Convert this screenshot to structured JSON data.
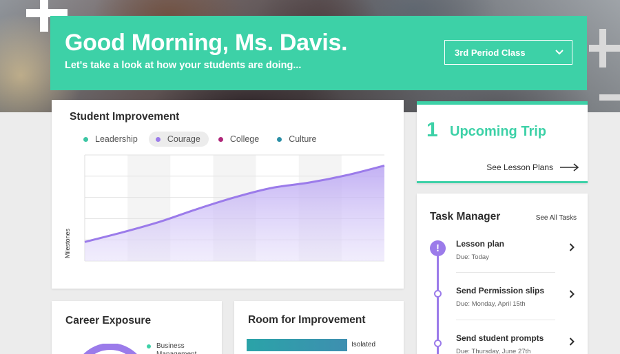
{
  "colors": {
    "accent_green": "#3dd1a7",
    "accent_purple": "#9b7bea",
    "teal": "#2aa3a8",
    "magenta": "#b0287a",
    "blue_teal": "#2b8fa6"
  },
  "banner": {
    "greeting": "Good Morning, Ms. Davis.",
    "subtitle": "Let's take a look at how your students are doing...",
    "class_select": "3rd Period Class",
    "class_select_icon": "chevron-down-icon"
  },
  "student_improvement": {
    "title": "Student Improvement",
    "legend": [
      {
        "label": "Leadership",
        "color": "#3dc6a4",
        "active": false
      },
      {
        "label": "Courage",
        "color": "#9b7bea",
        "active": true
      },
      {
        "label": "College",
        "color": "#b0287a",
        "active": false
      },
      {
        "label": "Culture",
        "color": "#2b8fa6",
        "active": false
      }
    ],
    "chart_data": {
      "type": "area",
      "ylabel": "Milestones",
      "xlabel": "",
      "ylim": [
        0,
        5
      ],
      "grid": true,
      "series": [
        {
          "x": [
            0,
            1,
            2,
            3,
            4,
            5,
            6,
            7,
            8
          ],
          "values": [
            0.9,
            1.35,
            1.85,
            2.45,
            3.0,
            3.45,
            3.7,
            4.05,
            4.5
          ]
        }
      ]
    }
  },
  "upcoming_trip": {
    "count": "1",
    "label": "Upcoming Trip",
    "link": "See Lesson Plans",
    "link_icon": "arrow-right-icon"
  },
  "task_manager": {
    "title": "Task Manager",
    "see_all": "See All Tasks",
    "alert_icon": "!",
    "tasks": [
      {
        "name": "Lesson plan",
        "due": "Due: Today"
      },
      {
        "name": "Send Permission slips",
        "due": "Due: Monday, April 15th"
      },
      {
        "name": "Send student prompts",
        "due": "Due: Thursday, June 27th"
      }
    ]
  },
  "career_exposure": {
    "title": "Career Exposure",
    "legend": [
      "Business Management"
    ]
  },
  "room_for_improvement": {
    "title": "Room for Improvement",
    "bars": [
      {
        "label": "Isolated"
      }
    ]
  }
}
